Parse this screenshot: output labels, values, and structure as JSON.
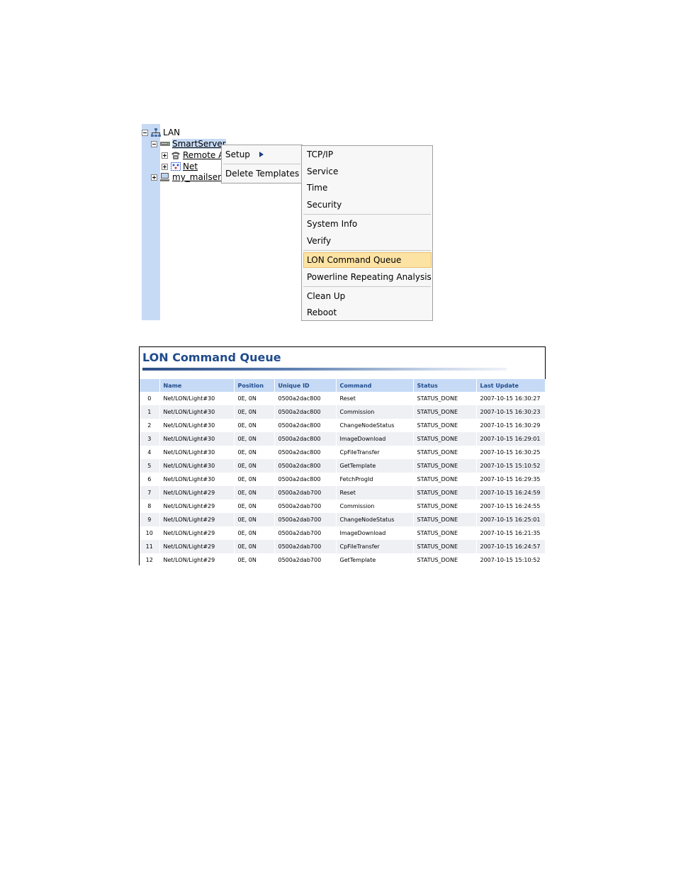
{
  "tree": {
    "items": [
      {
        "label": "LAN"
      },
      {
        "label": "SmartServer"
      },
      {
        "label": "Remote A"
      },
      {
        "label": "Net"
      },
      {
        "label": "my_mailser"
      }
    ]
  },
  "context_menu": {
    "items": [
      {
        "label": "Setup"
      },
      {
        "label": "Delete Templates"
      }
    ]
  },
  "setup_submenu": {
    "items": [
      {
        "label": "TCP/IP"
      },
      {
        "label": "Service"
      },
      {
        "label": "Time"
      },
      {
        "label": "Security"
      },
      {
        "label": "System Info"
      },
      {
        "label": "Verify"
      },
      {
        "label": "LON Command Queue"
      },
      {
        "label": "Powerline Repeating Analysis"
      },
      {
        "label": "Clean Up"
      },
      {
        "label": "Reboot"
      }
    ],
    "highlighted": "LON Command Queue"
  },
  "queue": {
    "title": "LON Command Queue",
    "columns": [
      "",
      "Name",
      "Position",
      "Unique ID",
      "Command",
      "Status",
      "Last Update"
    ],
    "rows": [
      [
        "0",
        "Net/LON/Light#30",
        "0E, 0N",
        "0500a2dac800",
        "Reset",
        "STATUS_DONE",
        "2007-10-15 16:30:27"
      ],
      [
        "1",
        "Net/LON/Light#30",
        "0E, 0N",
        "0500a2dac800",
        "Commission",
        "STATUS_DONE",
        "2007-10-15 16:30:23"
      ],
      [
        "2",
        "Net/LON/Light#30",
        "0E, 0N",
        "0500a2dac800",
        "ChangeNodeStatus",
        "STATUS_DONE",
        "2007-10-15 16:30:29"
      ],
      [
        "3",
        "Net/LON/Light#30",
        "0E, 0N",
        "0500a2dac800",
        "ImageDownload",
        "STATUS_DONE",
        "2007-10-15 16:29:01"
      ],
      [
        "4",
        "Net/LON/Light#30",
        "0E, 0N",
        "0500a2dac800",
        "CpFileTransfer",
        "STATUS_DONE",
        "2007-10-15 16:30:25"
      ],
      [
        "5",
        "Net/LON/Light#30",
        "0E, 0N",
        "0500a2dac800",
        "GetTemplate",
        "STATUS_DONE",
        "2007-10-15 15:10:52"
      ],
      [
        "6",
        "Net/LON/Light#30",
        "0E, 0N",
        "0500a2dac800",
        "FetchProgId",
        "STATUS_DONE",
        "2007-10-15 16:29:35"
      ],
      [
        "7",
        "Net/LON/Light#29",
        "0E, 0N",
        "0500a2dab700",
        "Reset",
        "STATUS_DONE",
        "2007-10-15 16:24:59"
      ],
      [
        "8",
        "Net/LON/Light#29",
        "0E, 0N",
        "0500a2dab700",
        "Commission",
        "STATUS_DONE",
        "2007-10-15 16:24:55"
      ],
      [
        "9",
        "Net/LON/Light#29",
        "0E, 0N",
        "0500a2dab700",
        "ChangeNodeStatus",
        "STATUS_DONE",
        "2007-10-15 16:25:01"
      ],
      [
        "10",
        "Net/LON/Light#29",
        "0E, 0N",
        "0500a2dab700",
        "ImageDownload",
        "STATUS_DONE",
        "2007-10-15 16:21:35"
      ],
      [
        "11",
        "Net/LON/Light#29",
        "0E, 0N",
        "0500a2dab700",
        "CpFileTransfer",
        "STATUS_DONE",
        "2007-10-15 16:24:57"
      ],
      [
        "12",
        "Net/LON/Light#29",
        "0E, 0N",
        "0500a2dab700",
        "GetTemplate",
        "STATUS_DONE",
        "2007-10-15 15:10:52"
      ]
    ]
  },
  "colors": {
    "accent": "#1f4b8c",
    "header_bg": "#c6daf5",
    "highlight": "#fce3a4"
  },
  "icons": {
    "network": "network-icon",
    "server": "server-icon",
    "phone": "phone-icon",
    "net": "net-icon",
    "computer": "computer-icon"
  }
}
